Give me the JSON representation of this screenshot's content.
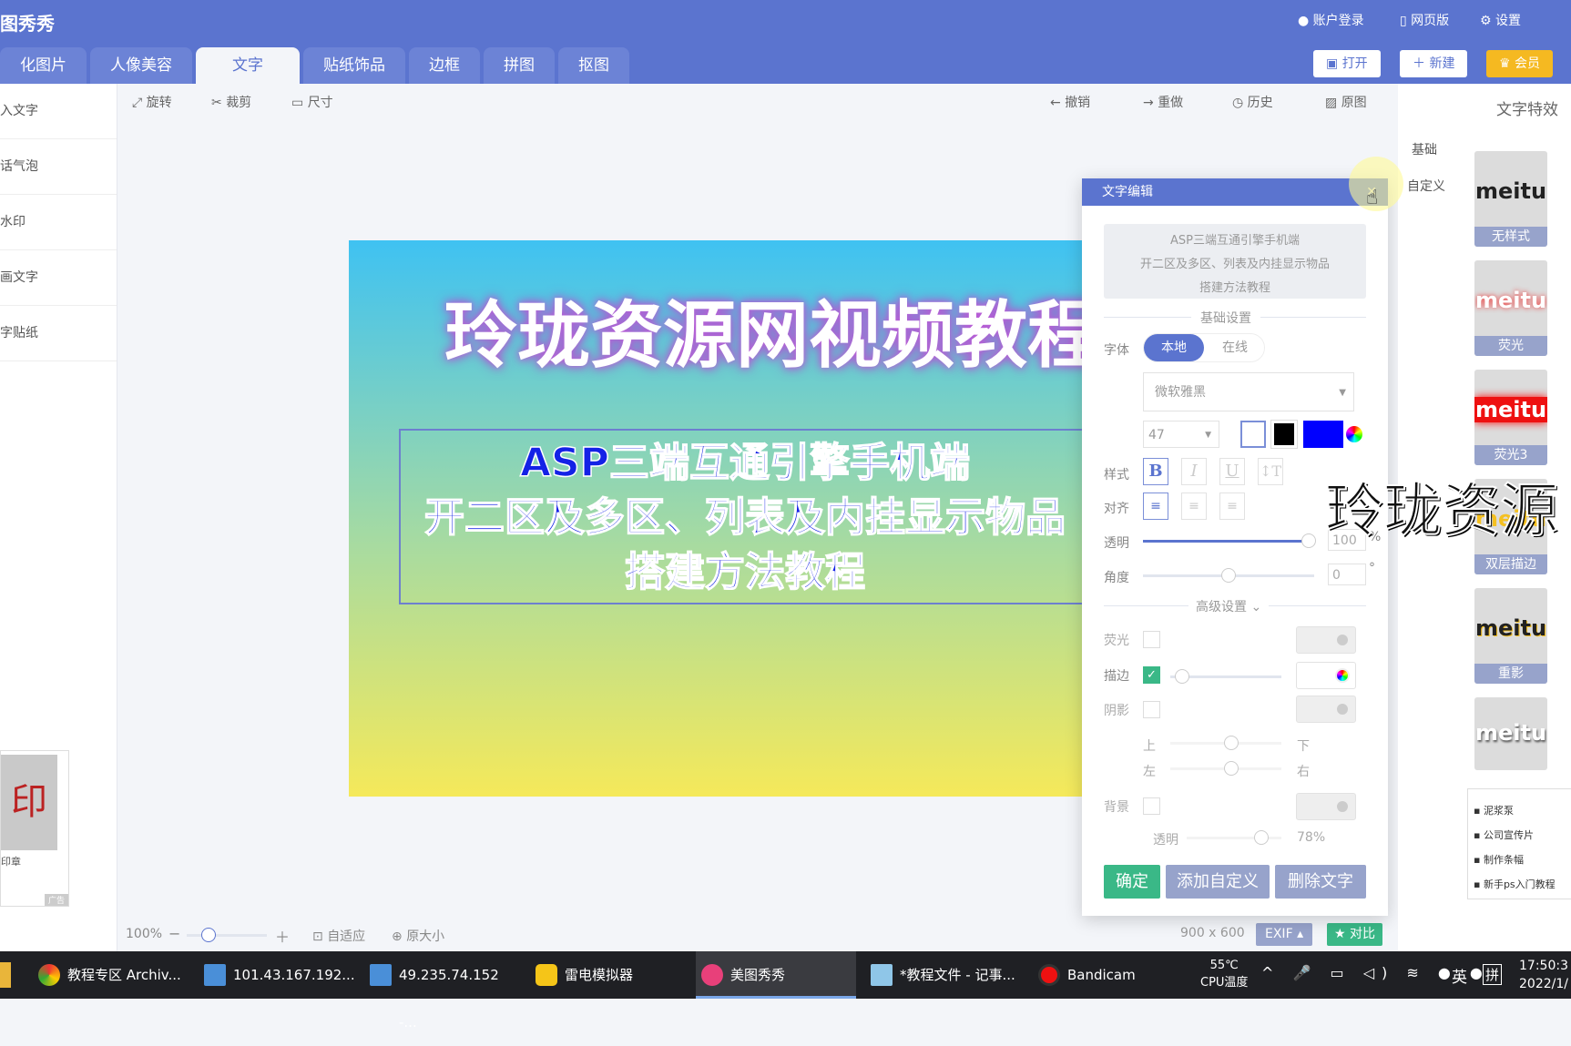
{
  "header": {
    "logo": "图秀秀",
    "account": "账户登录",
    "web": "网页版",
    "settings": "设置",
    "tabs": [
      "化图片",
      "人像美容",
      "文字",
      "贴纸饰品",
      "边框",
      "拼图",
      "抠图"
    ],
    "active_tab": "文字",
    "open": "打开",
    "new": "新建",
    "vip": "会员"
  },
  "sidebar": {
    "items": [
      "入文字",
      "话气泡",
      "水印",
      "画文字",
      "字贴纸"
    ],
    "thumb_label": "印章",
    "ad": "广告"
  },
  "toolbar": {
    "rotate": "旋转",
    "crop": "裁剪",
    "size": "尺寸",
    "undo": "撤销",
    "redo": "重做",
    "history": "历史",
    "original": "原图"
  },
  "canvas": {
    "title": "玲珑资源网视频教程",
    "lines": [
      "ASP三端互通引擎手机端",
      "开二区及多区、列表及内挂显示物品",
      "搭建方法教程"
    ]
  },
  "panel": {
    "title": "文字编辑",
    "text_value": "ASP三端互通引擎手机端\n开二区及多区、列表及内挂显示物品\n搭建方法教程",
    "basic": "基础设置",
    "font_label": "字体",
    "local": "本地",
    "online": "在线",
    "font": "微软雅黑",
    "size": "47",
    "text_color": "#0000ff",
    "stroke_color": "#000000",
    "style_label": "样式",
    "align_label": "对齐",
    "opacity_label": "透明",
    "opacity": "100",
    "pct": "%",
    "angle_label": "角度",
    "angle": "0",
    "deg": "°",
    "advanced": "高级设置",
    "glow": "荧光",
    "stroke": "描边",
    "stroke_checked": true,
    "shadow": "阴影",
    "up": "上",
    "down": "下",
    "left": "左",
    "right": "右",
    "bg": "背景",
    "bg_opacity_label": "透明",
    "bg_opacity": "78%",
    "ok": "确定",
    "add_custom": "添加自定义",
    "delete": "删除文字"
  },
  "rightbar": {
    "title": "文字特效",
    "tabs": [
      "基础",
      "自定义"
    ],
    "cards": [
      {
        "sample": "meitu",
        "name": "无样式"
      },
      {
        "sample": "meitu",
        "name": "荧光"
      },
      {
        "sample": "meitu",
        "name": "荧光3"
      },
      {
        "sample": "meitu",
        "name": "双层描边"
      },
      {
        "sample": "meitu",
        "name": "重影"
      },
      {
        "sample": "meitu",
        "name": ""
      }
    ],
    "links": [
      "泥浆泵",
      "公司宣传片",
      "制作条幅",
      "新手ps入门教程"
    ]
  },
  "overlay_text": "玲珑资源",
  "status": {
    "zoom": "100%",
    "fit": "自适应",
    "actual": "原大小",
    "dims": "900 x 600",
    "exif": "EXIF",
    "compare": "对比"
  },
  "taskbar": {
    "apps": [
      "教程专区 Archiv...",
      "101.43.167.192...",
      "49.235.74.152 -...",
      "雷电模拟器",
      "美图秀秀",
      "*教程文件 - 记事...",
      "Bandicam"
    ],
    "temp": "55℃",
    "temp_label": "CPU温度",
    "lang": "英",
    "ime": "拼",
    "time": "17:50:3",
    "date": "2022/1/"
  }
}
